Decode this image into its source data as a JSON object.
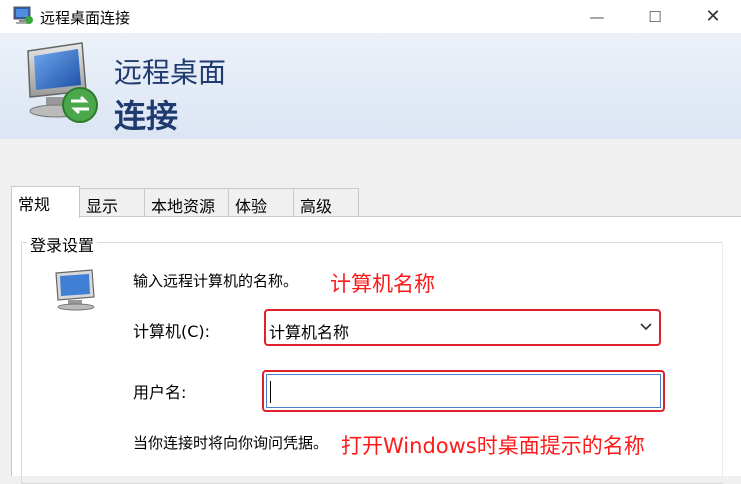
{
  "window": {
    "title": "远程桌面连接",
    "min_glyph": "—",
    "max_glyph": "☐",
    "close_glyph": "✕"
  },
  "banner": {
    "line1": "远程桌面",
    "line2": "连接"
  },
  "tabs": [
    {
      "label": "常规",
      "active": true
    },
    {
      "label": "显示",
      "active": false
    },
    {
      "label": "本地资源",
      "active": false
    },
    {
      "label": "体验",
      "active": false
    },
    {
      "label": "高级",
      "active": false
    }
  ],
  "login": {
    "group_title": "登录设置",
    "hint": "输入远程计算机的名称。",
    "computer_label": "计算机(C):",
    "computer_value": "计算机名称",
    "user_label": "用户名:",
    "user_value": "",
    "bottom_hint": "当你连接时将向你询问凭据。"
  },
  "annotations": {
    "computer_note": "计算机名称",
    "user_note": "打开Windows时桌面提示的名称"
  },
  "colors": {
    "annotation_red": "#ff1a1a",
    "highlight_border": "#e0202a",
    "banner_text": "#1f3a6e"
  },
  "icons": {
    "app": "remote-desktop-icon",
    "computer": "computer-icon"
  }
}
